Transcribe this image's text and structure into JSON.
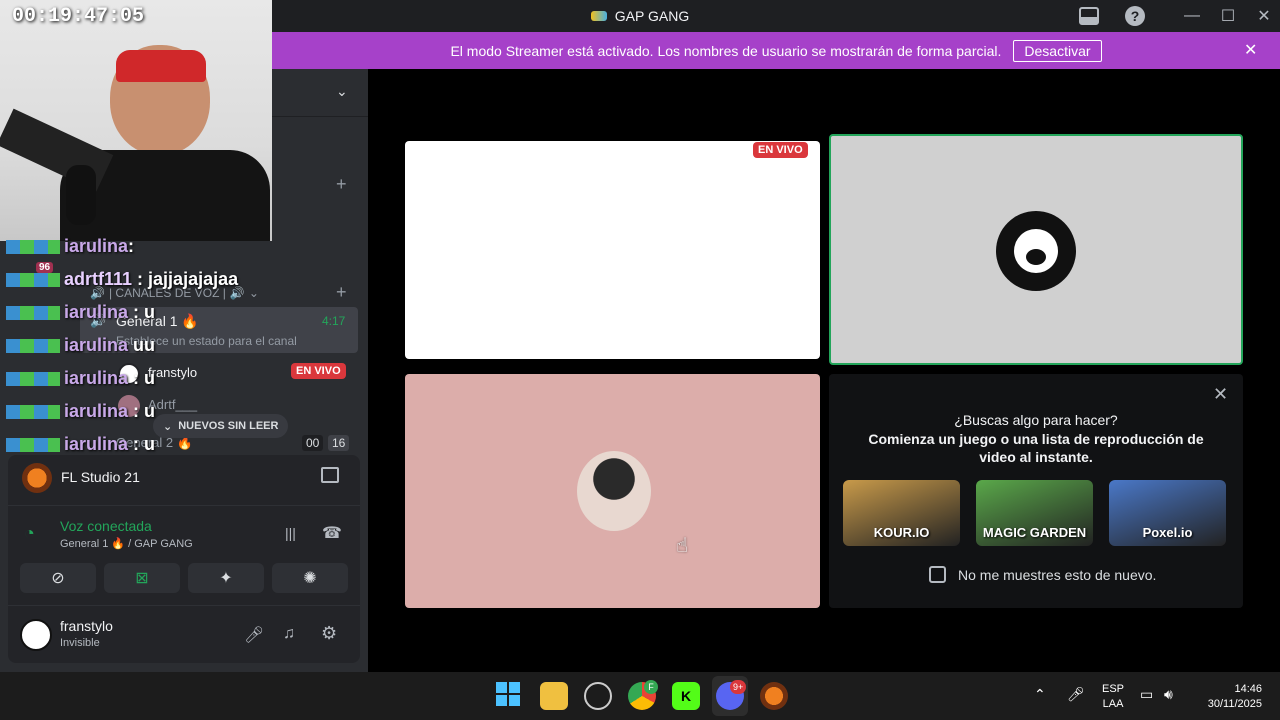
{
  "stream_timer": "00:19:47:05",
  "window": {
    "title": "GAP GANG",
    "minimize": "—",
    "maximize": "☐",
    "close": "✕"
  },
  "banner": {
    "text": "El modo Streamer está activado. Los nombres de usuario se mostrarán de forma parcial.",
    "button": "Desactivar",
    "close": "✕"
  },
  "sidebar": {
    "voice_category": "| CANALES DE VOZ |",
    "channels": [
      {
        "name": "General 1 🔥",
        "time": "4:17",
        "status_placeholder": "Establece un estado para el canal"
      },
      {
        "name": "General 2 🔥",
        "count_a": "00",
        "count_b": "16"
      }
    ],
    "members": [
      {
        "name": "franstylo",
        "badge": "EN VIVO"
      },
      {
        "name": "Adrtf___"
      }
    ],
    "new_unread": "NUEVOS SIN LEER"
  },
  "overlay_chat": [
    {
      "user": "iarulina",
      "msg": ": ",
      "color": "#c8a8e8"
    },
    {
      "user": "adrtf111",
      "msg": " : jajjajajajaa",
      "color": "#e8d0ff"
    },
    {
      "user": "iarulina",
      "msg": " : u",
      "color": "#c8a8e8"
    },
    {
      "user": "iarulina",
      "msg": " uu",
      "color": "#c8a8e8"
    },
    {
      "user": "iarulina",
      "msg": " : u",
      "color": "#c8a8e8"
    },
    {
      "user": "iarulina",
      "msg": " : u",
      "color": "#c8a8e8"
    },
    {
      "user": "iarulina",
      "msg": " : u",
      "color": "#c8a8e8"
    }
  ],
  "chat_badges": [
    "96"
  ],
  "activity": {
    "name": "FL Studio 21"
  },
  "voice": {
    "status": "Voz conectada",
    "channel": "General 1 🔥 / GAP GANG"
  },
  "user": {
    "name": "franstylo",
    "status": "Invisible"
  },
  "stage": {
    "live_badge": "EN VIVO",
    "activity_title": "¿Buscas algo para hacer?",
    "activity_desc": "Comienza un juego o una lista de reproducción de video al instante.",
    "games": [
      {
        "name": "KOUR.IO",
        "color": "#c89a4a"
      },
      {
        "name": "MAGIC GARDEN",
        "color": "#5aa84a"
      },
      {
        "name": "Poxel.io",
        "color": "#4a78c8"
      }
    ],
    "dont_show": "No me muestres esto de nuevo."
  },
  "taskbar": {
    "lang_1": "ESP",
    "lang_2": "LAA",
    "time": "14:46",
    "date": "30/11/2025",
    "discord_badge": "9+",
    "chrome_badge": "F"
  }
}
